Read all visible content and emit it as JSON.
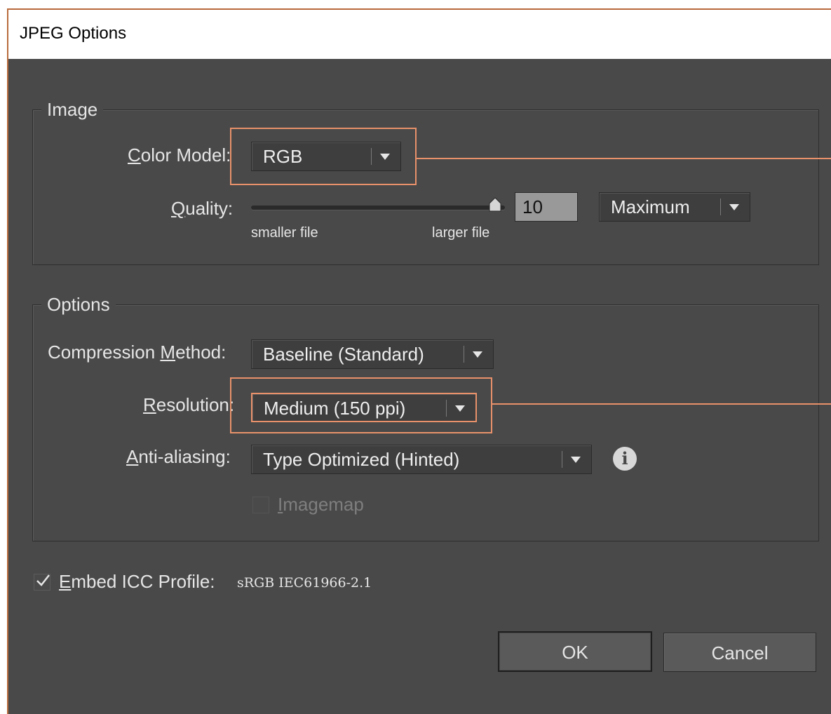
{
  "window": {
    "title": "JPEG Options"
  },
  "image_group": {
    "legend": "Image",
    "color_model": {
      "label_pre": "",
      "label_u": "C",
      "label_post": "olor Model:",
      "value": "RGB"
    },
    "quality": {
      "label_u": "Q",
      "label_post": "uality:",
      "value": "10",
      "preset": "Maximum",
      "min_label": "smaller file",
      "max_label": "larger file",
      "level": 1.0
    }
  },
  "options_group": {
    "legend": "Options",
    "compression": {
      "label_pre": "Compression ",
      "label_u": "M",
      "label_post": "ethod:",
      "value": "Baseline (Standard)"
    },
    "resolution": {
      "label_u": "R",
      "label_post": "esolution:",
      "value": "Medium (150 ppi)"
    },
    "anti_aliasing": {
      "label_u": "A",
      "label_post": "nti-aliasing:",
      "value": "Type Optimized (Hinted)"
    },
    "imagemap": {
      "label_u": "I",
      "label_post": "magemap",
      "checked": false,
      "enabled": false
    }
  },
  "embed_icc": {
    "label_u": "E",
    "label_post": "mbed ICC Profile:",
    "profile": "sRGB IEC61966-2.1",
    "checked": true
  },
  "buttons": {
    "ok": "OK",
    "cancel": "Cancel"
  },
  "colors": {
    "dialog_bg": "#494949",
    "highlight": "#e8916a",
    "window_border": "#b86a3c"
  },
  "icons": {
    "info": "info-icon",
    "dropdown": "chevron-down-icon",
    "check": "check-icon"
  }
}
